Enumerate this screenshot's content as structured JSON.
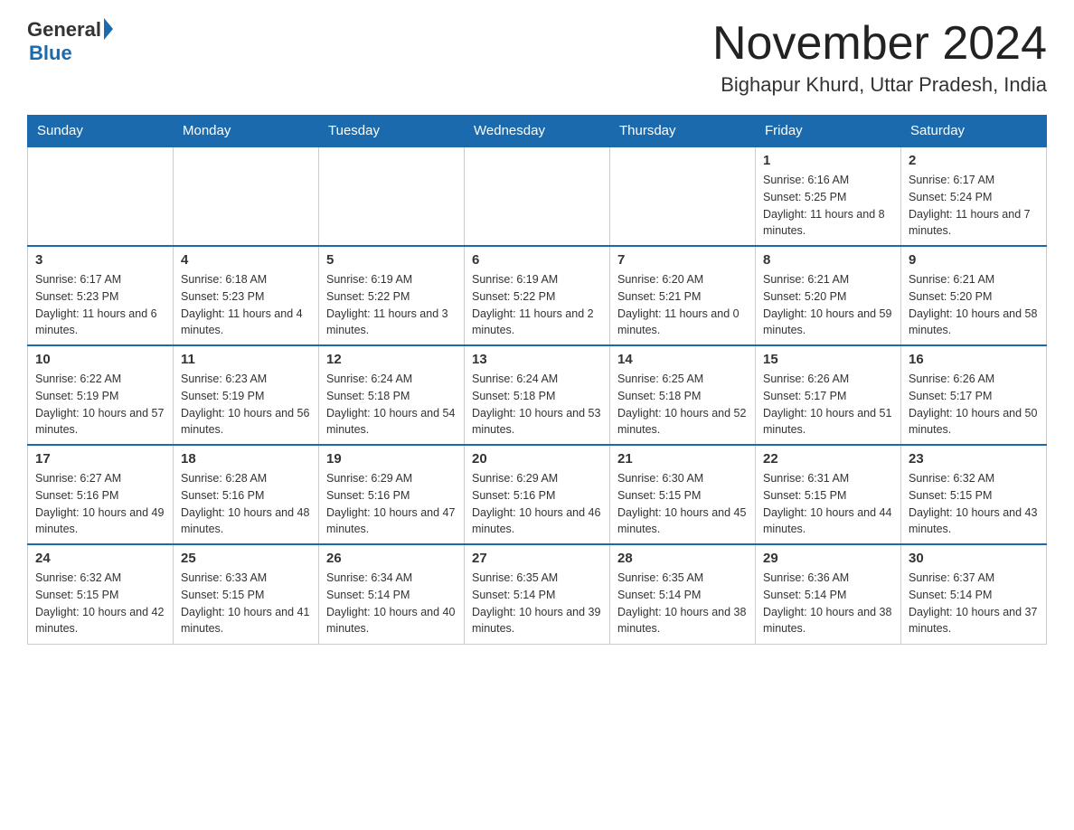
{
  "header": {
    "logo_general": "General",
    "logo_blue": "Blue",
    "month_title": "November 2024",
    "location": "Bighapur Khurd, Uttar Pradesh, India"
  },
  "weekdays": [
    "Sunday",
    "Monday",
    "Tuesday",
    "Wednesday",
    "Thursday",
    "Friday",
    "Saturday"
  ],
  "weeks": [
    [
      {
        "day": "",
        "info": ""
      },
      {
        "day": "",
        "info": ""
      },
      {
        "day": "",
        "info": ""
      },
      {
        "day": "",
        "info": ""
      },
      {
        "day": "",
        "info": ""
      },
      {
        "day": "1",
        "info": "Sunrise: 6:16 AM\nSunset: 5:25 PM\nDaylight: 11 hours and 8 minutes."
      },
      {
        "day": "2",
        "info": "Sunrise: 6:17 AM\nSunset: 5:24 PM\nDaylight: 11 hours and 7 minutes."
      }
    ],
    [
      {
        "day": "3",
        "info": "Sunrise: 6:17 AM\nSunset: 5:23 PM\nDaylight: 11 hours and 6 minutes."
      },
      {
        "day": "4",
        "info": "Sunrise: 6:18 AM\nSunset: 5:23 PM\nDaylight: 11 hours and 4 minutes."
      },
      {
        "day": "5",
        "info": "Sunrise: 6:19 AM\nSunset: 5:22 PM\nDaylight: 11 hours and 3 minutes."
      },
      {
        "day": "6",
        "info": "Sunrise: 6:19 AM\nSunset: 5:22 PM\nDaylight: 11 hours and 2 minutes."
      },
      {
        "day": "7",
        "info": "Sunrise: 6:20 AM\nSunset: 5:21 PM\nDaylight: 11 hours and 0 minutes."
      },
      {
        "day": "8",
        "info": "Sunrise: 6:21 AM\nSunset: 5:20 PM\nDaylight: 10 hours and 59 minutes."
      },
      {
        "day": "9",
        "info": "Sunrise: 6:21 AM\nSunset: 5:20 PM\nDaylight: 10 hours and 58 minutes."
      }
    ],
    [
      {
        "day": "10",
        "info": "Sunrise: 6:22 AM\nSunset: 5:19 PM\nDaylight: 10 hours and 57 minutes."
      },
      {
        "day": "11",
        "info": "Sunrise: 6:23 AM\nSunset: 5:19 PM\nDaylight: 10 hours and 56 minutes."
      },
      {
        "day": "12",
        "info": "Sunrise: 6:24 AM\nSunset: 5:18 PM\nDaylight: 10 hours and 54 minutes."
      },
      {
        "day": "13",
        "info": "Sunrise: 6:24 AM\nSunset: 5:18 PM\nDaylight: 10 hours and 53 minutes."
      },
      {
        "day": "14",
        "info": "Sunrise: 6:25 AM\nSunset: 5:18 PM\nDaylight: 10 hours and 52 minutes."
      },
      {
        "day": "15",
        "info": "Sunrise: 6:26 AM\nSunset: 5:17 PM\nDaylight: 10 hours and 51 minutes."
      },
      {
        "day": "16",
        "info": "Sunrise: 6:26 AM\nSunset: 5:17 PM\nDaylight: 10 hours and 50 minutes."
      }
    ],
    [
      {
        "day": "17",
        "info": "Sunrise: 6:27 AM\nSunset: 5:16 PM\nDaylight: 10 hours and 49 minutes."
      },
      {
        "day": "18",
        "info": "Sunrise: 6:28 AM\nSunset: 5:16 PM\nDaylight: 10 hours and 48 minutes."
      },
      {
        "day": "19",
        "info": "Sunrise: 6:29 AM\nSunset: 5:16 PM\nDaylight: 10 hours and 47 minutes."
      },
      {
        "day": "20",
        "info": "Sunrise: 6:29 AM\nSunset: 5:16 PM\nDaylight: 10 hours and 46 minutes."
      },
      {
        "day": "21",
        "info": "Sunrise: 6:30 AM\nSunset: 5:15 PM\nDaylight: 10 hours and 45 minutes."
      },
      {
        "day": "22",
        "info": "Sunrise: 6:31 AM\nSunset: 5:15 PM\nDaylight: 10 hours and 44 minutes."
      },
      {
        "day": "23",
        "info": "Sunrise: 6:32 AM\nSunset: 5:15 PM\nDaylight: 10 hours and 43 minutes."
      }
    ],
    [
      {
        "day": "24",
        "info": "Sunrise: 6:32 AM\nSunset: 5:15 PM\nDaylight: 10 hours and 42 minutes."
      },
      {
        "day": "25",
        "info": "Sunrise: 6:33 AM\nSunset: 5:15 PM\nDaylight: 10 hours and 41 minutes."
      },
      {
        "day": "26",
        "info": "Sunrise: 6:34 AM\nSunset: 5:14 PM\nDaylight: 10 hours and 40 minutes."
      },
      {
        "day": "27",
        "info": "Sunrise: 6:35 AM\nSunset: 5:14 PM\nDaylight: 10 hours and 39 minutes."
      },
      {
        "day": "28",
        "info": "Sunrise: 6:35 AM\nSunset: 5:14 PM\nDaylight: 10 hours and 38 minutes."
      },
      {
        "day": "29",
        "info": "Sunrise: 6:36 AM\nSunset: 5:14 PM\nDaylight: 10 hours and 38 minutes."
      },
      {
        "day": "30",
        "info": "Sunrise: 6:37 AM\nSunset: 5:14 PM\nDaylight: 10 hours and 37 minutes."
      }
    ]
  ]
}
